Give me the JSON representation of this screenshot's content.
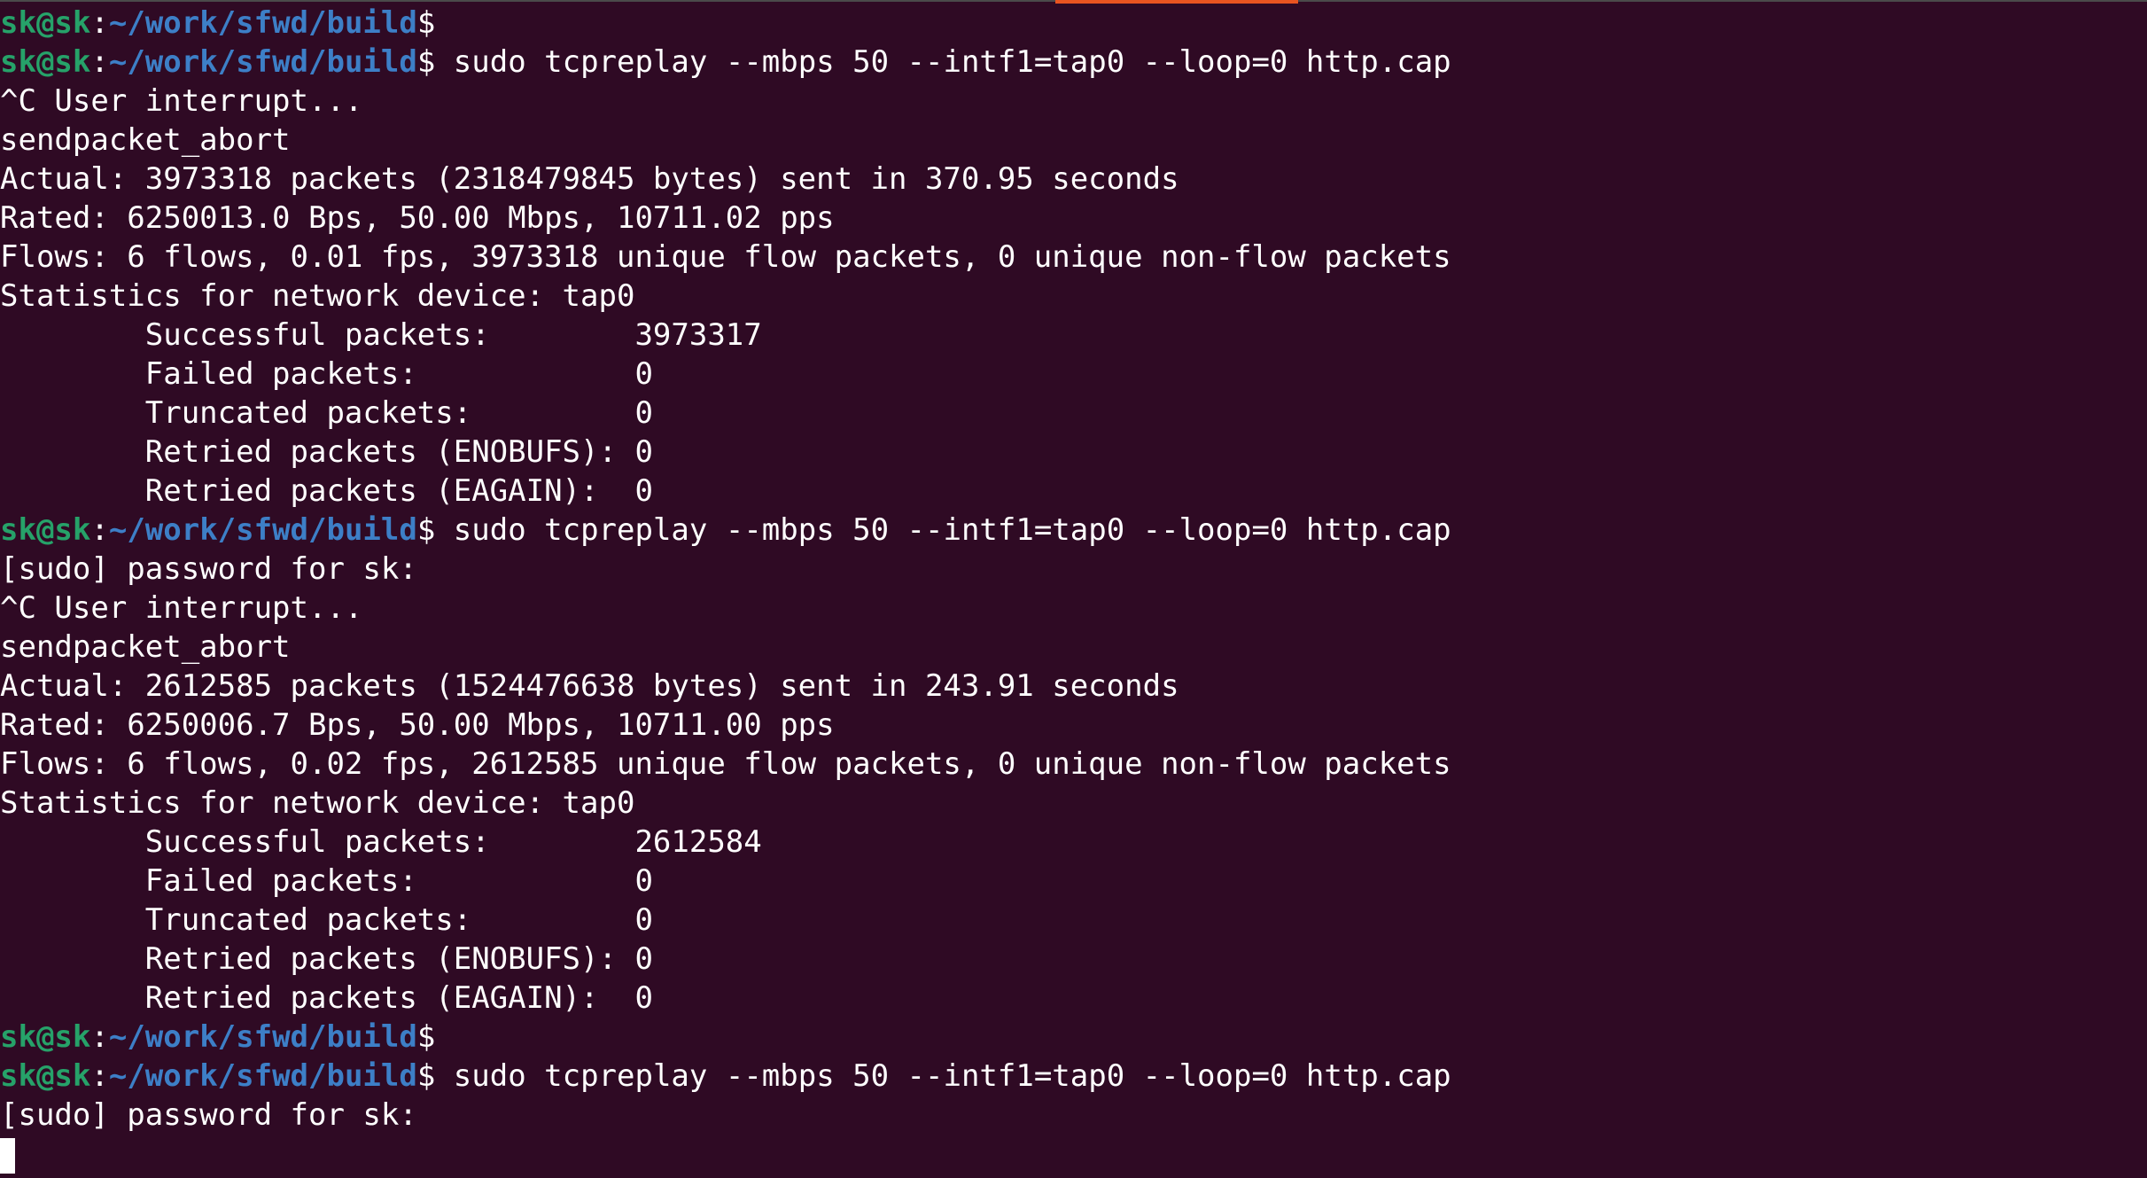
{
  "prompt": {
    "user_host": "sk@sk",
    "colon": ":",
    "path": "~/work/sfwd/build",
    "dollar": "$"
  },
  "colors": {
    "background": "#2f0a24",
    "user": "#26a269",
    "path": "#3d7fc7",
    "text": "#ffffff",
    "tab_accent": "#e95420"
  },
  "lines": [
    {
      "type": "prompt",
      "command": ""
    },
    {
      "type": "prompt",
      "command": " sudo tcpreplay --mbps 50 --intf1=tap0 --loop=0 http.cap"
    },
    {
      "type": "output",
      "text": "^C User interrupt..."
    },
    {
      "type": "output",
      "text": "sendpacket_abort"
    },
    {
      "type": "output",
      "text": "Actual: 3973318 packets (2318479845 bytes) sent in 370.95 seconds"
    },
    {
      "type": "output",
      "text": "Rated: 6250013.0 Bps, 50.00 Mbps, 10711.02 pps"
    },
    {
      "type": "output",
      "text": "Flows: 6 flows, 0.01 fps, 3973318 unique flow packets, 0 unique non-flow packets"
    },
    {
      "type": "output",
      "text": "Statistics for network device: tap0"
    },
    {
      "type": "output",
      "text": "        Successful packets:        3973317"
    },
    {
      "type": "output",
      "text": "        Failed packets:            0"
    },
    {
      "type": "output",
      "text": "        Truncated packets:         0"
    },
    {
      "type": "output",
      "text": "        Retried packets (ENOBUFS): 0"
    },
    {
      "type": "output",
      "text": "        Retried packets (EAGAIN):  0"
    },
    {
      "type": "prompt",
      "command": " sudo tcpreplay --mbps 50 --intf1=tap0 --loop=0 http.cap"
    },
    {
      "type": "output",
      "text": "[sudo] password for sk:"
    },
    {
      "type": "output",
      "text": "^C User interrupt..."
    },
    {
      "type": "output",
      "text": "sendpacket_abort"
    },
    {
      "type": "output",
      "text": "Actual: 2612585 packets (1524476638 bytes) sent in 243.91 seconds"
    },
    {
      "type": "output",
      "text": "Rated: 6250006.7 Bps, 50.00 Mbps, 10711.00 pps"
    },
    {
      "type": "output",
      "text": "Flows: 6 flows, 0.02 fps, 2612585 unique flow packets, 0 unique non-flow packets"
    },
    {
      "type": "output",
      "text": "Statistics for network device: tap0"
    },
    {
      "type": "output",
      "text": "        Successful packets:        2612584"
    },
    {
      "type": "output",
      "text": "        Failed packets:            0"
    },
    {
      "type": "output",
      "text": "        Truncated packets:         0"
    },
    {
      "type": "output",
      "text": "        Retried packets (ENOBUFS): 0"
    },
    {
      "type": "output",
      "text": "        Retried packets (EAGAIN):  0"
    },
    {
      "type": "prompt",
      "command": ""
    },
    {
      "type": "prompt",
      "command": " sudo tcpreplay --mbps 50 --intf1=tap0 --loop=0 http.cap"
    },
    {
      "type": "output",
      "text": "[sudo] password for sk:"
    },
    {
      "type": "cursor"
    }
  ]
}
